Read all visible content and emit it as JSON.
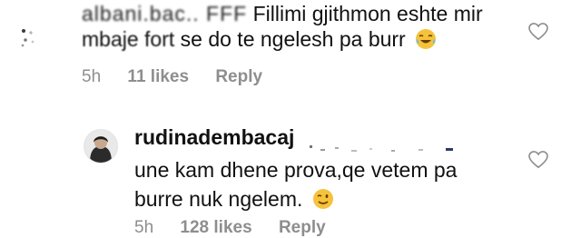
{
  "comments": [
    {
      "username_partial": "albani.bac.. ",
      "text_line1_prefix": "FFF",
      "text_line1": "Fillimi gjithmon eshte mir",
      "text_line2_prefix": "mbaje fort",
      "text_line2": " se do te ngelesh pa burr",
      "emoji": "laughing-tears-emoji",
      "age": "5h",
      "likes": "11 likes",
      "reply": "Reply"
    },
    {
      "username": "rudinadembacaj",
      "text_line1": "une kam dhene prova,qe vetem pa",
      "text_line2": "burre nuk ngelem.",
      "emoji": "winking-face-emoji",
      "age": "5h",
      "likes": "128 likes",
      "reply": "Reply"
    }
  ],
  "icons": {
    "heart": "heart-outline-icon"
  },
  "colors": {
    "text": "#111111",
    "meta": "#8e8e8e",
    "emoji": "#f5c33b"
  }
}
